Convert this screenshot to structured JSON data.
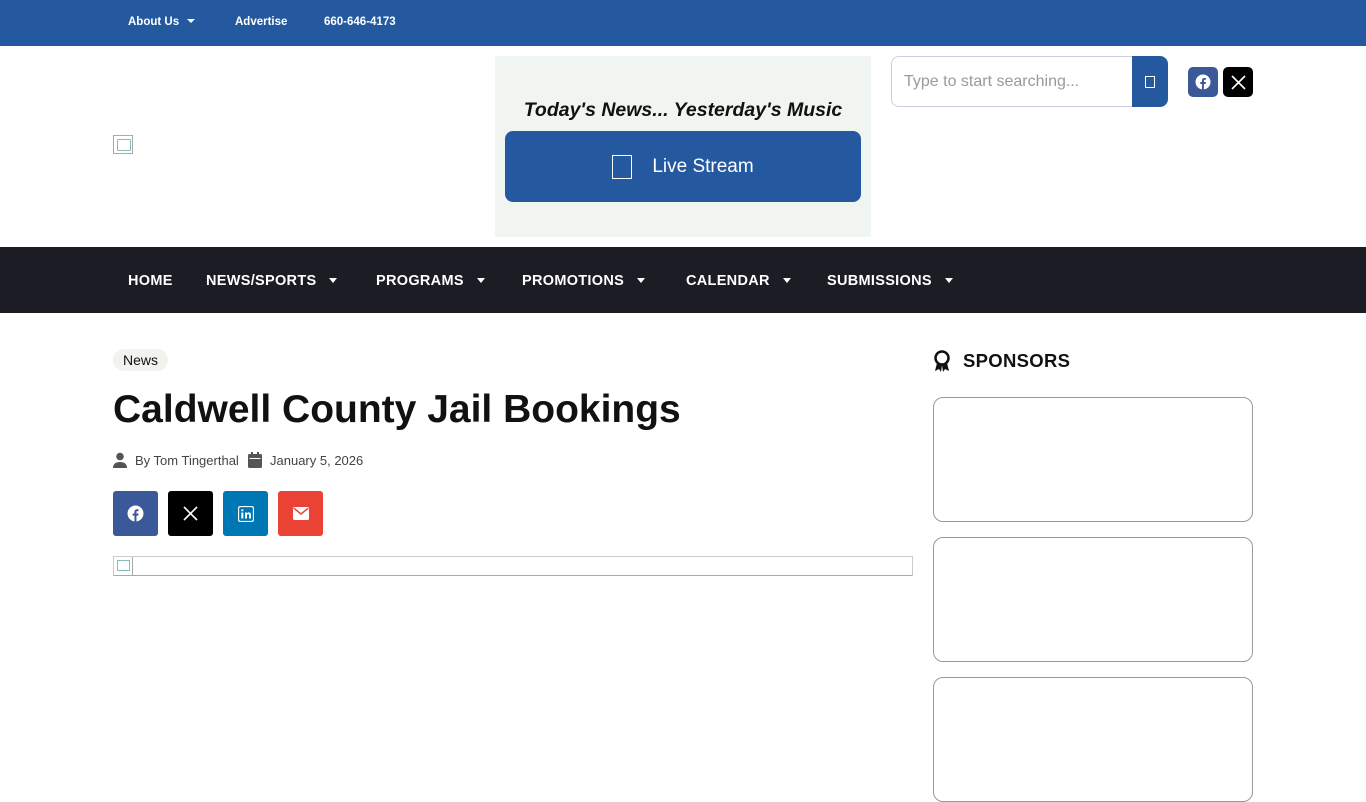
{
  "topbar": {
    "about": "About Us",
    "advertise": "Advertise",
    "phone": "660-646-4173"
  },
  "header": {
    "tagline": "Today's News... Yesterday's Music",
    "live_stream_label": "Live Stream",
    "search_placeholder": "Type to start searching..."
  },
  "nav": {
    "items": [
      "HOME",
      "NEWS/SPORTS",
      "PROGRAMS",
      "PROMOTIONS",
      "CALENDAR",
      "SUBMISSIONS"
    ]
  },
  "article": {
    "category": "News",
    "title": "Caldwell County Jail Bookings",
    "author": "By Tom Tingerthal",
    "date": "January 5, 2026"
  },
  "sidebar": {
    "heading": "SPONSORS"
  },
  "colors": {
    "brand_blue": "#2459a0",
    "nav_dark": "#1c1c24",
    "facebook": "#3b5998",
    "linkedin": "#0077b5",
    "email": "#ea4335"
  }
}
